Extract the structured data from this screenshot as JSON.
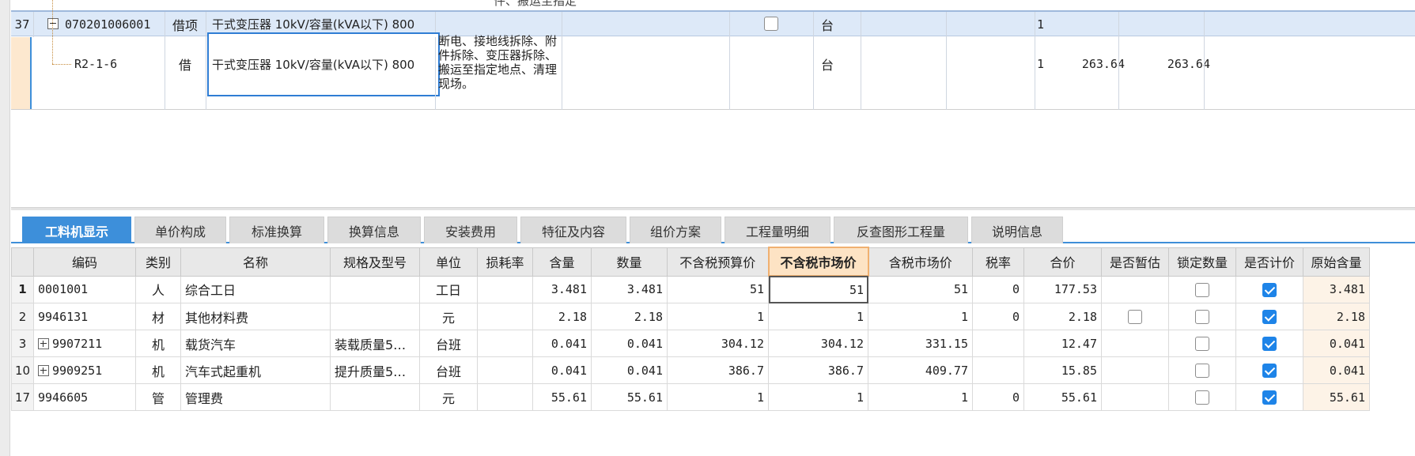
{
  "top_grid": {
    "row37": {
      "row_no": "37",
      "code": "070201006001",
      "type": "借项",
      "name": "干式变压器 10kV/容量(kVA以下) 800",
      "unit": "台",
      "qty": "1"
    },
    "row_sub": {
      "code": "R2-1-6",
      "type": "借",
      "name": "干式变压器 10kV/容量(kVA以下) 800",
      "content": "断电、接地线拆除、附件拆除、变压器拆除、搬运至指定地点、清理现场。",
      "unit": "台",
      "qty": "1",
      "price": "263.64",
      "total": "263.64"
    },
    "cut_text": "件、搬运至指定"
  },
  "tabs": [
    "工料机显示",
    "单价构成",
    "标准换算",
    "换算信息",
    "安装费用",
    "特征及内容",
    "组价方案",
    "工程量明细",
    "反查图形工程量",
    "说明信息"
  ],
  "columns": [
    "编码",
    "类别",
    "名称",
    "规格及型号",
    "单位",
    "损耗率",
    "含量",
    "数量",
    "不含税预算价",
    "不含税市场价",
    "含税市场价",
    "税率",
    "合价",
    "是否暂估",
    "锁定数量",
    "是否计价",
    "原始含量"
  ],
  "rows": [
    {
      "no": "1",
      "code": "0001001",
      "cat": "人",
      "name": "综合工日",
      "spec": "",
      "unit": "工日",
      "loss": "",
      "content": "3.481",
      "qty": "3.481",
      "budget": "51",
      "market": "51",
      "market_tax": "51",
      "tax_rate": "0",
      "total": "177.53",
      "orig": "3.481"
    },
    {
      "no": "2",
      "code": "9946131",
      "cat": "材",
      "name": "其他材料费",
      "spec": "",
      "unit": "元",
      "loss": "",
      "content": "2.18",
      "qty": "2.18",
      "budget": "1",
      "market": "1",
      "market_tax": "1",
      "tax_rate": "0",
      "total": "2.18",
      "orig": "2.18"
    },
    {
      "no": "3",
      "code": "9907211",
      "cat": "机",
      "name": "载货汽车",
      "spec": "装载质量5…",
      "unit": "台班",
      "loss": "",
      "content": "0.041",
      "qty": "0.041",
      "budget": "304.12",
      "market": "304.12",
      "market_tax": "331.15",
      "tax_rate": "",
      "total": "12.47",
      "orig": "0.041"
    },
    {
      "no": "10",
      "code": "9909251",
      "cat": "机",
      "name": "汽车式起重机",
      "spec": "提升质量5…",
      "unit": "台班",
      "loss": "",
      "content": "0.041",
      "qty": "0.041",
      "budget": "386.7",
      "market": "386.7",
      "market_tax": "409.77",
      "tax_rate": "",
      "total": "15.85",
      "orig": "0.041"
    },
    {
      "no": "17",
      "code": "9946605",
      "cat": "管",
      "name": "管理费",
      "spec": "",
      "unit": "元",
      "loss": "",
      "content": "55.61",
      "qty": "55.61",
      "budget": "1",
      "market": "1",
      "market_tax": "1",
      "tax_rate": "0",
      "total": "55.61",
      "orig": "55.61"
    }
  ],
  "colors": {
    "accent": "#3d8fda",
    "selected_row": "#dde9f8",
    "highlight_header": "#fde3c4",
    "checkbox_on": "#1e84e8"
  }
}
